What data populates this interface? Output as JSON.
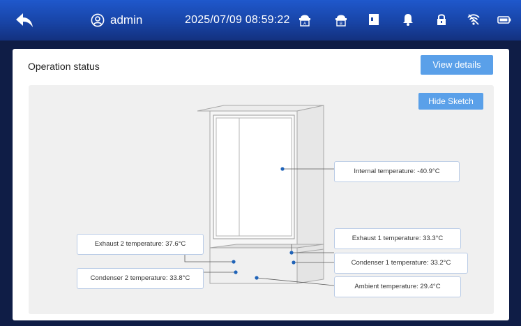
{
  "header": {
    "user": "admin",
    "datetime": "2025/07/09 08:59:22",
    "icons": [
      "back-arrow-icon",
      "user-icon",
      "printer-a-icon",
      "printer-b-icon",
      "door-icon",
      "bell-icon",
      "lock-icon",
      "wifi-icon",
      "battery-icon"
    ]
  },
  "panel": {
    "title": "Operation status",
    "view_details": "View details",
    "hide_sketch": "Hide Sketch"
  },
  "readings": {
    "internal": "Internal temperature: -40.9°C",
    "exhaust1": "Exhaust 1 temperature: 33.3°C",
    "condenser1": "Condenser 1 temperature: 33.2°C",
    "ambient": "Ambient temperature: 29.4°C",
    "exhaust2": "Exhaust 2 temperature: 37.6°C",
    "condenser2": "Condenser 2 temperature: 33.8°C"
  },
  "colors": {
    "header_top": "#1f58cc",
    "background": "#0f1d46",
    "accent_button": "#5aa0e9",
    "sensor_dot": "#1f63b8"
  }
}
